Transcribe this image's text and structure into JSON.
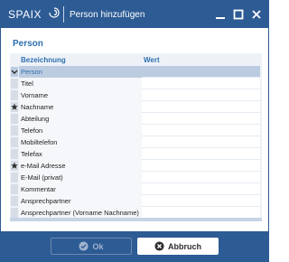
{
  "titlebar": {
    "logo_text": "SPAIX",
    "title": "Person hinzufügen",
    "minimize_icon": "minimize-icon",
    "maximize_icon": "maximize-icon",
    "close_icon": "close-icon"
  },
  "section_heading": "Person",
  "grid": {
    "headers": {
      "name": "Bezeichnung",
      "value": "Wert"
    },
    "rows": [
      {
        "label": "Person",
        "group": true,
        "marker": "chevron-down-icon",
        "value": ""
      },
      {
        "label": "Titel",
        "group": false,
        "marker": "",
        "value": ""
      },
      {
        "label": "Vorname",
        "group": false,
        "marker": "",
        "value": ""
      },
      {
        "label": "Nachname",
        "group": false,
        "marker": "required-star-icon",
        "value": ""
      },
      {
        "label": "Abteilung",
        "group": false,
        "marker": "",
        "value": ""
      },
      {
        "label": "Telefon",
        "group": false,
        "marker": "",
        "value": ""
      },
      {
        "label": "Mobiltelefon",
        "group": false,
        "marker": "",
        "value": ""
      },
      {
        "label": "Telefax",
        "group": false,
        "marker": "",
        "value": ""
      },
      {
        "label": "e-Mail Adresse",
        "group": false,
        "marker": "required-star-icon",
        "value": ""
      },
      {
        "label": "E-Mail (privat)",
        "group": false,
        "marker": "",
        "value": ""
      },
      {
        "label": "Kommentar",
        "group": false,
        "marker": "",
        "value": ""
      },
      {
        "label": "Ansprechpartner",
        "group": false,
        "marker": "",
        "value": ""
      },
      {
        "label": "Ansprechpartner (Vorname Nachname)",
        "group": false,
        "marker": "",
        "value": ""
      }
    ]
  },
  "buttons": {
    "ok_label": "Ok",
    "cancel_label": "Abbruch"
  },
  "colors": {
    "brand": "#2d5b94",
    "heading": "#2d6fb0",
    "group_row": "#bccce0"
  }
}
